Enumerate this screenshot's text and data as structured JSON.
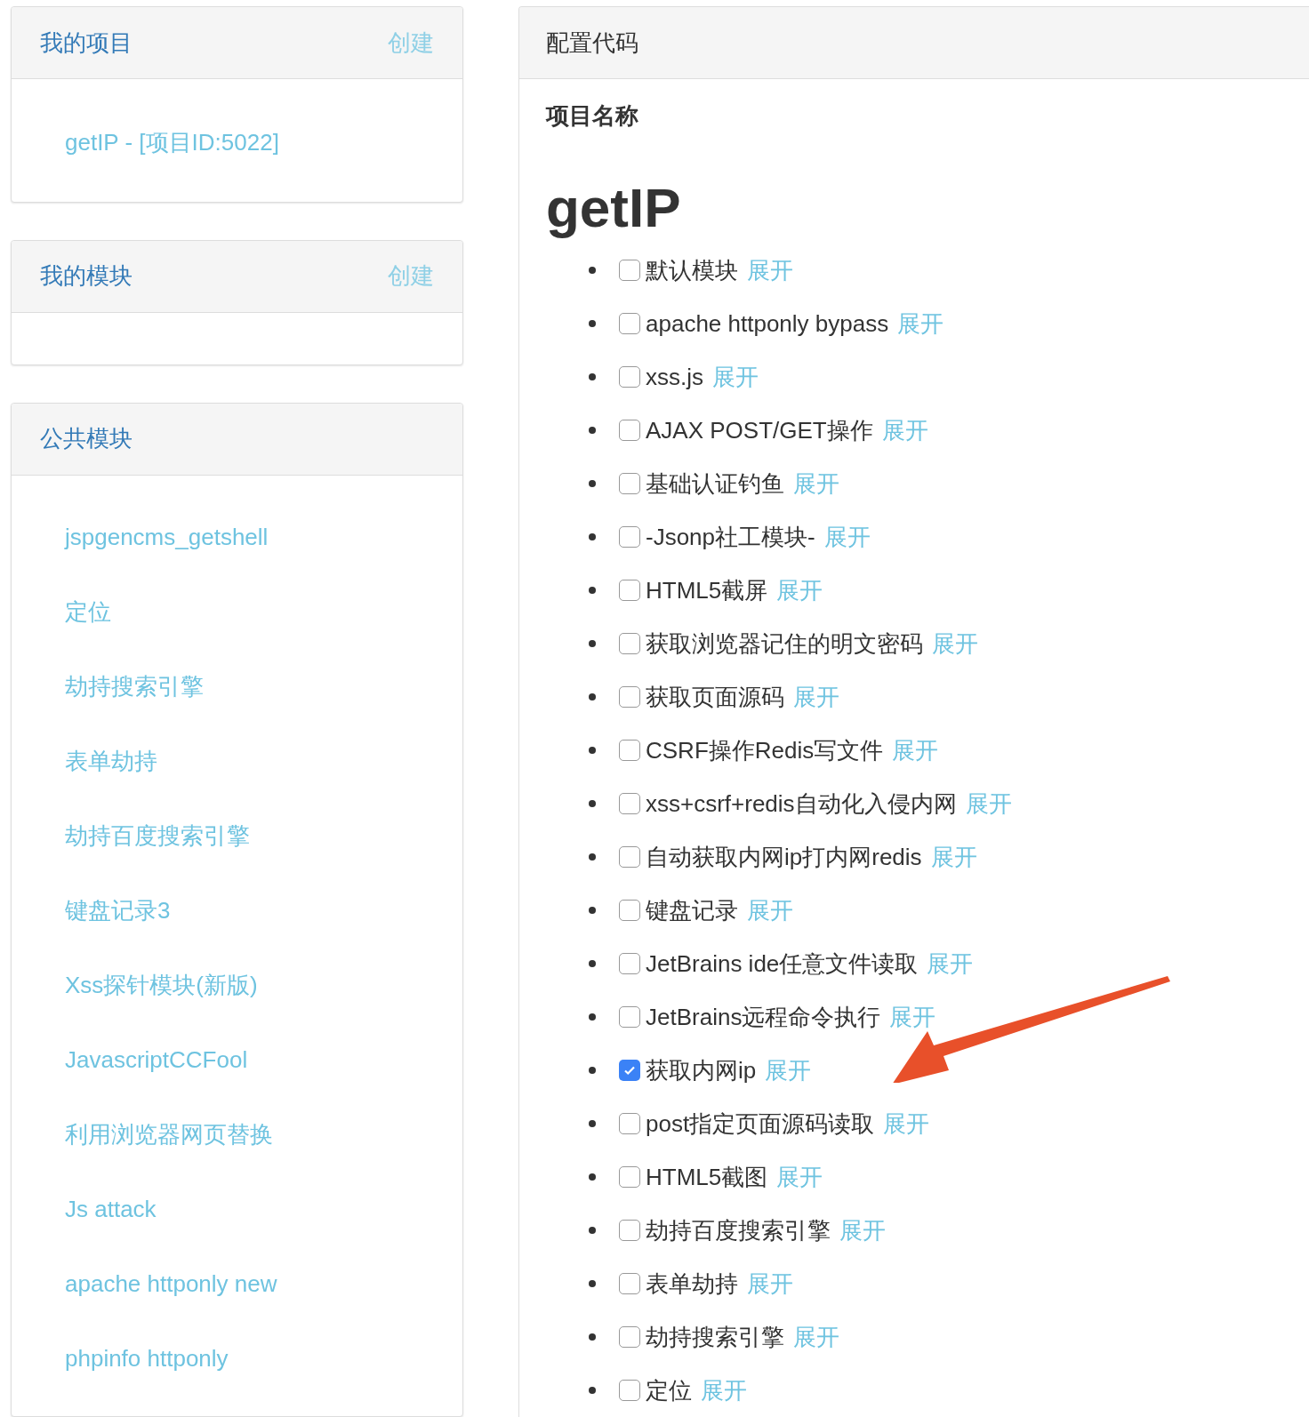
{
  "sidebar": {
    "panels": [
      {
        "title": "我的项目",
        "action": "创建",
        "items": [
          "getIP - [项目ID:5022]"
        ]
      },
      {
        "title": "我的模块",
        "action": "创建"
      },
      {
        "title": "公共模块",
        "items": [
          "jspgencms_getshell",
          "定位",
          "劫持搜索引擎",
          "表单劫持",
          "劫持百度搜索引擎",
          "键盘记录3",
          "Xss探针模块(新版)",
          "JavascriptCCFool",
          "利用浏览器网页替换",
          "Js attack",
          "apache httponly new",
          "phpinfo httponly"
        ]
      }
    ]
  },
  "main": {
    "title": "配置代码",
    "label": "项目名称",
    "project_name": "getIP",
    "modules": [
      {
        "name": "默认模块",
        "checked": false,
        "action": "展开"
      },
      {
        "name": "apache httponly bypass",
        "checked": false,
        "action": "展开"
      },
      {
        "name": "xss.js",
        "checked": false,
        "action": "展开"
      },
      {
        "name": "AJAX POST/GET操作",
        "checked": false,
        "action": "展开"
      },
      {
        "name": "基础认证钓鱼",
        "checked": false,
        "action": "展开"
      },
      {
        "name": "-Jsonp社工模块-",
        "checked": false,
        "action": "展开"
      },
      {
        "name": "HTML5截屏",
        "checked": false,
        "action": "展开"
      },
      {
        "name": "获取浏览器记住的明文密码",
        "checked": false,
        "action": "展开"
      },
      {
        "name": "获取页面源码",
        "checked": false,
        "action": "展开"
      },
      {
        "name": "CSRF操作Redis写文件",
        "checked": false,
        "action": "展开"
      },
      {
        "name": "xss+csrf+redis自动化入侵内网",
        "checked": false,
        "action": "展开"
      },
      {
        "name": "自动获取内网ip打内网redis",
        "checked": false,
        "action": "展开"
      },
      {
        "name": "键盘记录",
        "checked": false,
        "action": "展开"
      },
      {
        "name": "JetBrains ide任意文件读取",
        "checked": false,
        "action": "展开"
      },
      {
        "name": "JetBrains远程命令执行",
        "checked": false,
        "action": "展开"
      },
      {
        "name": "获取内网ip",
        "checked": true,
        "action": "展开"
      },
      {
        "name": "post指定页面源码读取",
        "checked": false,
        "action": "展开"
      },
      {
        "name": "HTML5截图",
        "checked": false,
        "action": "展开"
      },
      {
        "name": "劫持百度搜索引擎",
        "checked": false,
        "action": "展开"
      },
      {
        "name": "表单劫持",
        "checked": false,
        "action": "展开"
      },
      {
        "name": "劫持搜索引擎",
        "checked": false,
        "action": "展开"
      },
      {
        "name": "定位",
        "checked": false,
        "action": "展开"
      }
    ]
  }
}
